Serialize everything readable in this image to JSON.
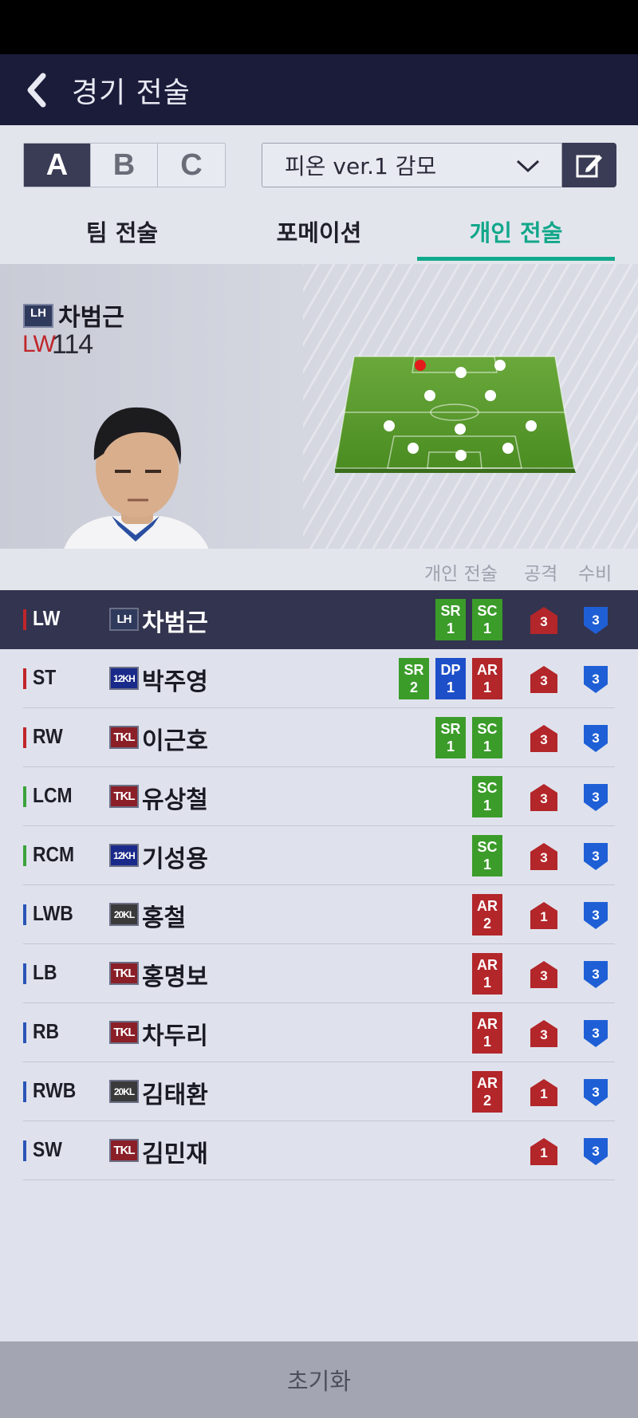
{
  "header": {
    "title": "경기 전술"
  },
  "toolbar": {
    "presets": [
      "A",
      "B",
      "C"
    ],
    "active_preset": "A",
    "manager_select": {
      "value": "피온 ver.1 감모"
    }
  },
  "tabs": [
    {
      "label": "팀 전술",
      "active": false
    },
    {
      "label": "포메이션",
      "active": false
    },
    {
      "label": "개인 전술",
      "active": true
    }
  ],
  "hero": {
    "season_badge": "LH",
    "name": "차범근",
    "position": "LW",
    "ovr": "114"
  },
  "columns": {
    "individual": "개인 전술",
    "attack": "공격",
    "defense": "수비"
  },
  "players": [
    {
      "pos": "LW",
      "line": "attack",
      "season": "LH",
      "name": "차범근",
      "tactics": [
        {
          "code": "SR",
          "lv": "1",
          "color": "green"
        },
        {
          "code": "SC",
          "lv": "1",
          "color": "green"
        }
      ],
      "attack": "3",
      "defense": "3",
      "selected": true
    },
    {
      "pos": "ST",
      "line": "attack",
      "season": "12KH",
      "name": "박주영",
      "tactics": [
        {
          "code": "SR",
          "lv": "2",
          "color": "green"
        },
        {
          "code": "DP",
          "lv": "1",
          "color": "blue"
        },
        {
          "code": "AR",
          "lv": "1",
          "color": "red"
        }
      ],
      "attack": "3",
      "defense": "3"
    },
    {
      "pos": "RW",
      "line": "attack",
      "season": "TKL",
      "name": "이근호",
      "tactics": [
        {
          "code": "SR",
          "lv": "1",
          "color": "green"
        },
        {
          "code": "SC",
          "lv": "1",
          "color": "green"
        }
      ],
      "attack": "3",
      "defense": "3"
    },
    {
      "pos": "LCM",
      "line": "mid",
      "season": "TKL",
      "name": "유상철",
      "tactics": [
        {
          "code": "SC",
          "lv": "1",
          "color": "green"
        }
      ],
      "attack": "3",
      "defense": "3"
    },
    {
      "pos": "RCM",
      "line": "mid",
      "season": "12KH",
      "name": "기성용",
      "tactics": [
        {
          "code": "SC",
          "lv": "1",
          "color": "green"
        }
      ],
      "attack": "3",
      "defense": "3"
    },
    {
      "pos": "LWB",
      "line": "defense",
      "season": "20KL",
      "name": "홍철",
      "tactics": [
        {
          "code": "AR",
          "lv": "2",
          "color": "red"
        }
      ],
      "attack": "1",
      "defense": "3"
    },
    {
      "pos": "LB",
      "line": "defense",
      "season": "TKL",
      "name": "홍명보",
      "tactics": [
        {
          "code": "AR",
          "lv": "1",
          "color": "red"
        }
      ],
      "attack": "3",
      "defense": "3"
    },
    {
      "pos": "RB",
      "line": "defense",
      "season": "TKL",
      "name": "차두리",
      "tactics": [
        {
          "code": "AR",
          "lv": "1",
          "color": "red"
        }
      ],
      "attack": "3",
      "defense": "3"
    },
    {
      "pos": "RWB",
      "line": "defense",
      "season": "20KL",
      "name": "김태환",
      "tactics": [
        {
          "code": "AR",
          "lv": "2",
          "color": "red"
        }
      ],
      "attack": "1",
      "defense": "3"
    },
    {
      "pos": "SW",
      "line": "defense",
      "season": "TKL",
      "name": "김민재",
      "tactics": [],
      "attack": "1",
      "defense": "3"
    }
  ],
  "reset_label": "초기화",
  "colors": {
    "tactic_green": "#3b9c2a",
    "tactic_blue": "#1d4fc9",
    "tactic_red": "#b3262a",
    "line_attack": "#c0252b",
    "line_mid": "#3aa33a",
    "line_defense": "#2a55b8",
    "accent": "#13a98c"
  }
}
